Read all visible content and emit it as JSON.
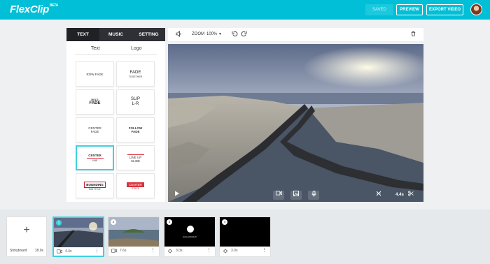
{
  "app": {
    "logo": "FlexClip",
    "logo_badge": "BETA",
    "saved_label": "SAVED",
    "preview_label": "PREVIEW",
    "export_label": "EXPORT VIDEO"
  },
  "left_panel": {
    "main_tabs": [
      {
        "label": "TEXT",
        "active": true
      },
      {
        "label": "MUSIC",
        "active": false
      },
      {
        "label": "SETTING",
        "active": false
      }
    ],
    "sub_tabs": [
      {
        "label": "Text",
        "active": true
      },
      {
        "label": "Logo",
        "active": false
      }
    ],
    "tiles": [
      {
        "line1": "ROW FADE"
      },
      {
        "line1": "FADE",
        "line2": "TOGETHER"
      },
      {
        "line1": "BOLD",
        "line2": "FADE"
      },
      {
        "line1": "SLIP",
        "line2": "L-R"
      },
      {
        "line1": "CENTER",
        "line2": "FADE"
      },
      {
        "line1": "FOLLOW",
        "line2": "FADE"
      },
      {
        "line1": "CENTER",
        "line2": "LINE",
        "selected": true
      },
      {
        "line1": "LINE UP",
        "line2": "SLIDE"
      },
      {
        "line1": "BOUNDING",
        "line2": "BIG TITLE"
      },
      {
        "line1": "CENTER",
        "line2": "STACK"
      }
    ]
  },
  "editor_toolbar": {
    "zoom_label": "ZOOM",
    "zoom_value": "100%"
  },
  "player": {
    "duration": "4.4s"
  },
  "storyboard": {
    "label": "Storyboard",
    "total_duration": "18.0s",
    "clips": [
      {
        "number": "1",
        "duration": "4.4s",
        "kind": "video",
        "selected": true
      },
      {
        "number": "2",
        "duration": "7.6s",
        "kind": "video",
        "selected": false
      },
      {
        "number": "3",
        "duration": "3.0s",
        "kind": "color",
        "selected": false,
        "overlay_text": "www.website.fr"
      },
      {
        "number": "4",
        "duration": "3.0s",
        "kind": "color",
        "selected": false
      }
    ]
  },
  "colors": {
    "brand": "#00bfd6",
    "selected": "#3fd0e0",
    "dark_tab": "#2e3035"
  }
}
